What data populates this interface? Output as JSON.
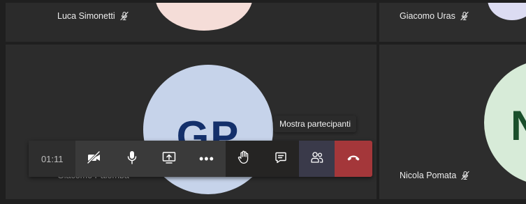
{
  "tiles": [
    {
      "name": "Luca Simonetti"
    },
    {
      "name": "Giacomo Uras"
    },
    {
      "name": "Giacomo Palomba",
      "initials": "GP"
    },
    {
      "name": "Nicola Pomata",
      "initials": "N"
    }
  ],
  "toolbar": {
    "timer": "01:11",
    "more_label": "•••"
  },
  "tooltip": {
    "text": "Mostra partecipanti"
  },
  "colors": {
    "hangup": "#a4373a",
    "avatar_gp": "#c6d3ea",
    "avatar_n": "#d7ebd8"
  }
}
